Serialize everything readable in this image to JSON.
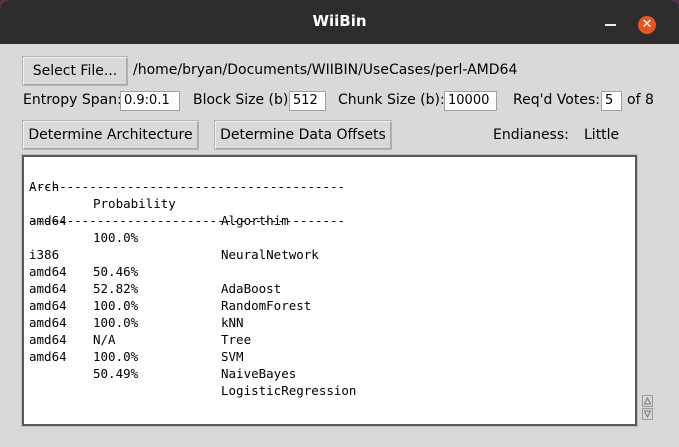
{
  "window": {
    "title": "WiiBin",
    "close_glyph": "✕"
  },
  "file": {
    "select_label": "Select File...",
    "path": "/home/bryan/Documents/WIIBIN/UseCases/perl-AMD64"
  },
  "params": {
    "entropy_label": "Entropy Span:",
    "entropy_value": "0.9:0.1",
    "block_label": "Block Size (b):",
    "block_value": "512",
    "chunk_label": "Chunk Size (b):",
    "chunk_value": "10000",
    "votes_label": "Req'd Votes:",
    "votes_value": "5",
    "votes_suffix": "of 8"
  },
  "actions": {
    "determine_arch_label": "Determine Architecture",
    "determine_offsets_label": "Determine Data Offsets",
    "endianness_label": "Endianess:",
    "endianness_value": "Little"
  },
  "output": {
    "header": {
      "arch": "Arch",
      "prob": "Probability",
      "algo": "Algorthim"
    },
    "divider": "------------------------------------------",
    "summary": {
      "arch": "amd64",
      "prob": "100.0%",
      "algo": "NeuralNetwork"
    },
    "rows": [
      {
        "arch": "i386",
        "prob": "50.46%",
        "algo": "AdaBoost"
      },
      {
        "arch": "amd64",
        "prob": "52.82%",
        "algo": "RandomForest"
      },
      {
        "arch": "amd64",
        "prob": "100.0%",
        "algo": "kNN"
      },
      {
        "arch": "amd64",
        "prob": "100.0%",
        "algo": "Tree"
      },
      {
        "arch": "amd64",
        "prob": "N/A",
        "algo": "SVM"
      },
      {
        "arch": "amd64",
        "prob": "100.0%",
        "algo": "NaiveBayes"
      },
      {
        "arch": "amd64",
        "prob": "50.49%",
        "algo": "LogisticRegression"
      }
    ]
  }
}
